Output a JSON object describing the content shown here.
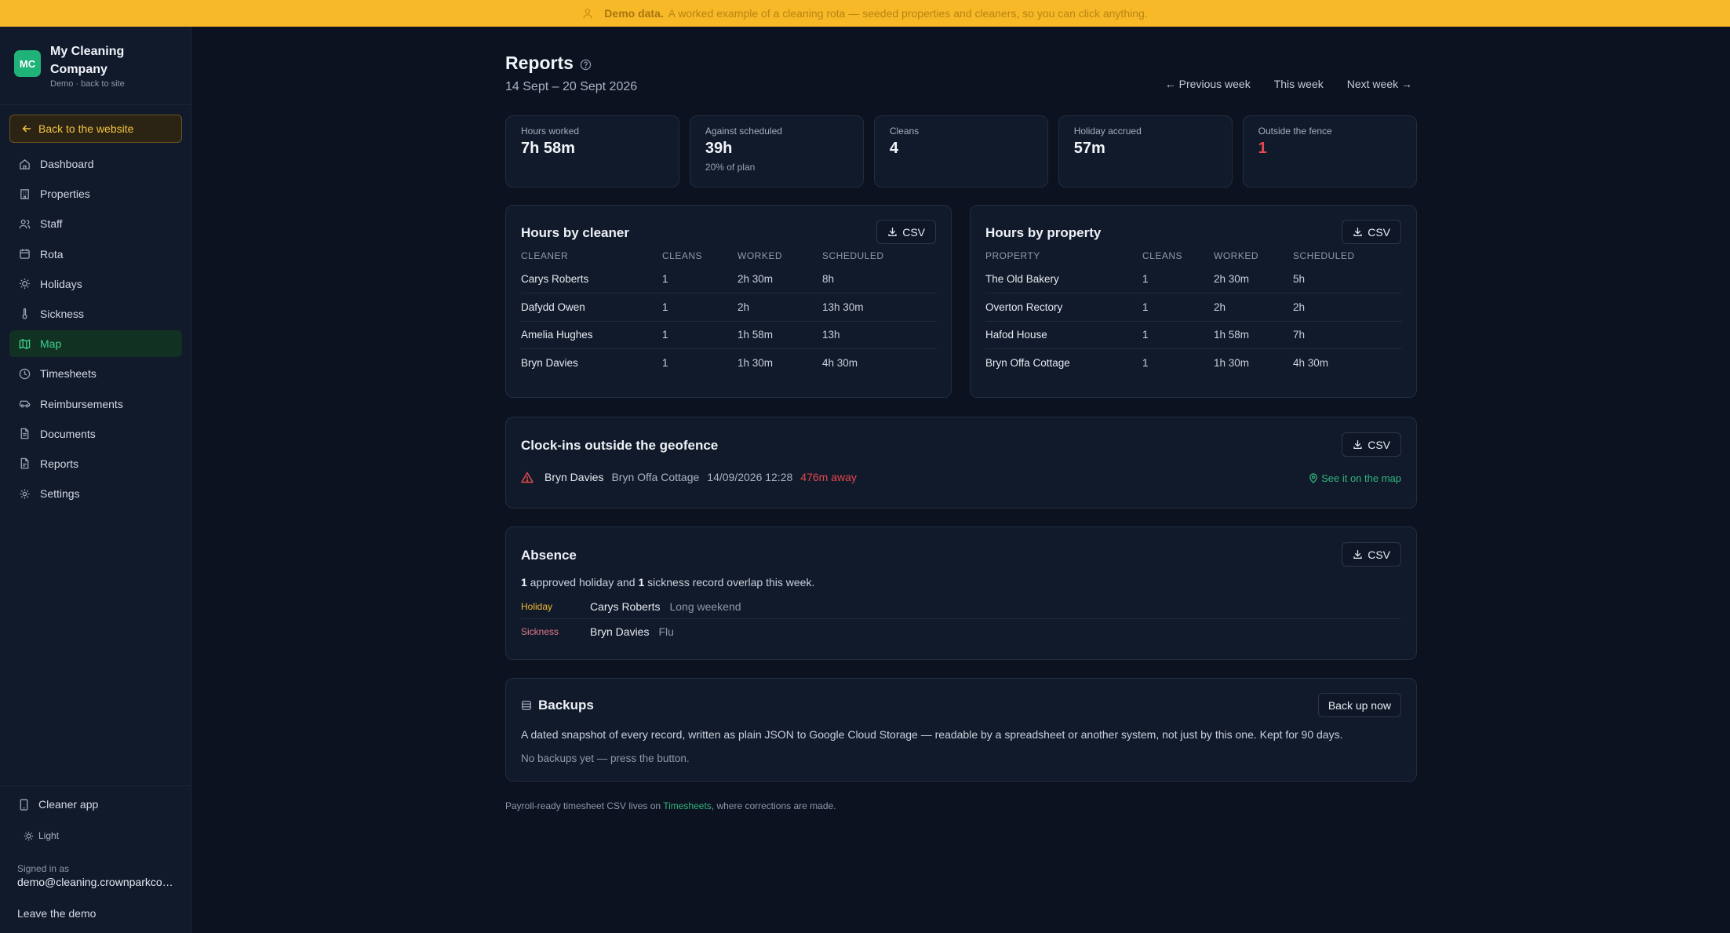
{
  "banner": {
    "bold": "Demo data.",
    "text": "A worked example of a cleaning rota — seeded properties and cleaners, so you can click anything."
  },
  "brand": {
    "initials": "MC",
    "name": "My Cleaning Company",
    "sub": "Demo · back to site"
  },
  "sidebar": {
    "back_label": "Back to the website",
    "items": [
      {
        "label": "Dashboard",
        "icon": "home-icon"
      },
      {
        "label": "Properties",
        "icon": "building-icon"
      },
      {
        "label": "Staff",
        "icon": "users-icon"
      },
      {
        "label": "Rota",
        "icon": "calendar-icon"
      },
      {
        "label": "Holidays",
        "icon": "sun-icon"
      },
      {
        "label": "Sickness",
        "icon": "thermometer-icon"
      },
      {
        "label": "Map",
        "icon": "map-icon",
        "active": true
      },
      {
        "label": "Timesheets",
        "icon": "clock-icon"
      },
      {
        "label": "Reimbursements",
        "icon": "car-icon"
      },
      {
        "label": "Documents",
        "icon": "file-icon"
      },
      {
        "label": "Reports",
        "icon": "report-icon"
      },
      {
        "label": "Settings",
        "icon": "gear-icon"
      }
    ],
    "cleaner_app": "Cleaner app",
    "theme_toggle": "Light",
    "signed_in_label": "Signed in as",
    "signed_in_email": "demo@cleaning.crownparkconsulting.co.uk",
    "leave_demo": "Leave the demo"
  },
  "header": {
    "title": "Reports",
    "date_range": "14 Sept – 20 Sept 2026",
    "prev_week": "← Previous week",
    "this_week": "This week",
    "next_week": "Next week →"
  },
  "stats": [
    {
      "label": "Hours worked",
      "value": "7h 58m",
      "sub": ""
    },
    {
      "label": "Against scheduled",
      "value": "39h",
      "sub": "20% of plan"
    },
    {
      "label": "Cleans",
      "value": "4",
      "sub": ""
    },
    {
      "label": "Holiday accrued",
      "value": "57m",
      "sub": ""
    },
    {
      "label": "Outside the fence",
      "value": "1",
      "sub": "",
      "alert": true
    }
  ],
  "csv_label": "CSV",
  "hours_by_cleaner": {
    "title": "Hours by cleaner",
    "columns": [
      "CLEANER",
      "CLEANS",
      "WORKED",
      "SCHEDULED"
    ],
    "rows": [
      [
        "Carys Roberts",
        "1",
        "2h 30m",
        "8h"
      ],
      [
        "Dafydd Owen",
        "1",
        "2h",
        "13h 30m"
      ],
      [
        "Amelia Hughes",
        "1",
        "1h 58m",
        "13h"
      ],
      [
        "Bryn Davies",
        "1",
        "1h 30m",
        "4h 30m"
      ]
    ]
  },
  "hours_by_property": {
    "title": "Hours by property",
    "columns": [
      "PROPERTY",
      "CLEANS",
      "WORKED",
      "SCHEDULED"
    ],
    "rows": [
      [
        "The Old Bakery",
        "1",
        "2h 30m",
        "5h"
      ],
      [
        "Overton Rectory",
        "1",
        "2h",
        "2h"
      ],
      [
        "Hafod House",
        "1",
        "1h 58m",
        "7h"
      ],
      [
        "Bryn Offa Cottage",
        "1",
        "1h 30m",
        "4h 30m"
      ]
    ]
  },
  "geofence": {
    "title": "Clock-ins outside the geofence",
    "entry": {
      "name": "Bryn Davies",
      "property": "Bryn Offa Cottage",
      "time": "14/09/2026 12:28",
      "distance": "476m away"
    },
    "map_link": "See it on the map"
  },
  "absence": {
    "title": "Absence",
    "summary_count1": "1",
    "summary_mid": " approved holiday and ",
    "summary_count2": "1",
    "summary_end": " sickness record overlap this week.",
    "rows": [
      {
        "type": "Holiday",
        "name": "Carys Roberts",
        "note": "Long weekend"
      },
      {
        "type": "Sickness",
        "name": "Bryn Davies",
        "note": "Flu"
      }
    ]
  },
  "backups": {
    "title": "Backups",
    "button": "Back up now",
    "description": "A dated snapshot of every record, written as plain JSON to Google Cloud Storage — readable by a spreadsheet or another system, not just by this one. Kept for 90 days.",
    "empty": "No backups yet — press the button."
  },
  "footnote": {
    "before": "Payroll-ready timesheet CSV lives on ",
    "link": "Timesheets",
    "after": ", where corrections are made."
  },
  "colors": {
    "accent_green": "#1fb37a",
    "banner_yellow": "#f7b928",
    "alert_red": "#e5484d",
    "background": "#0c1220"
  }
}
